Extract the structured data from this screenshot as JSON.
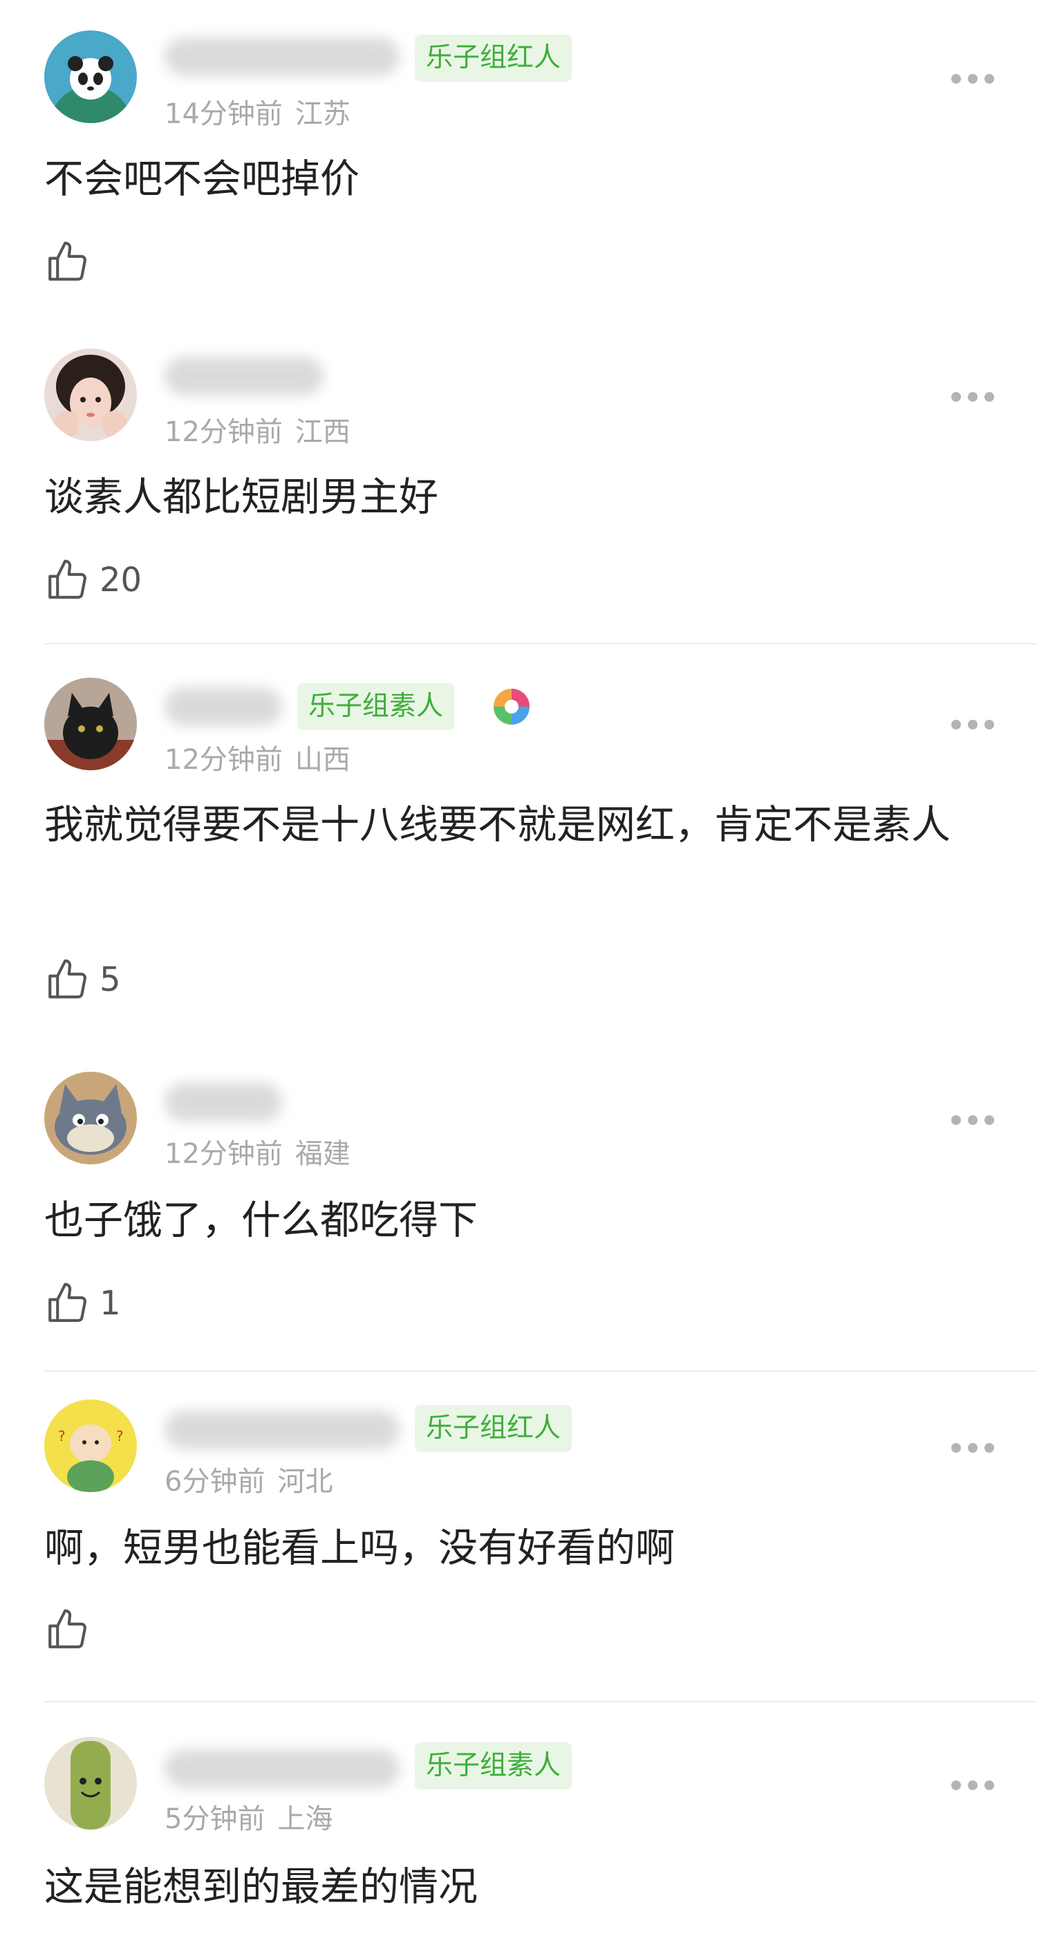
{
  "comments": [
    {
      "badge": "乐子组红人",
      "time": "14分钟前",
      "region": "江苏",
      "text": "不会吧不会吧掉价",
      "likes": ""
    },
    {
      "badge": "",
      "time": "12分钟前",
      "region": "江西",
      "text": "谈素人都比短剧男主好",
      "likes": "20"
    },
    {
      "badge": "乐子组素人",
      "time": "12分钟前",
      "region": "山西",
      "text": "我就觉得要不是十八线要不就是网红，肯定不是素人",
      "likes": "5"
    },
    {
      "badge": "",
      "time": "12分钟前",
      "region": "福建",
      "text": "也子饿了，什么都吃得下",
      "likes": "1"
    },
    {
      "badge": "乐子组红人",
      "time": "6分钟前",
      "region": "河北",
      "text": "啊，短男也能看上吗，没有好看的啊",
      "likes": ""
    },
    {
      "badge": "乐子组素人",
      "time": "5分钟前",
      "region": "上海",
      "text": "这是能想到的最差的情况",
      "likes": ""
    }
  ],
  "icons": {
    "like": "thumbs-up-icon",
    "more": "more-dots-icon",
    "emblem": "rainbow-donut-badge-icon"
  },
  "colors": {
    "badge_bg": "#e9f6e6",
    "badge_text": "#3fae3a",
    "meta": "#a9a9a9"
  }
}
